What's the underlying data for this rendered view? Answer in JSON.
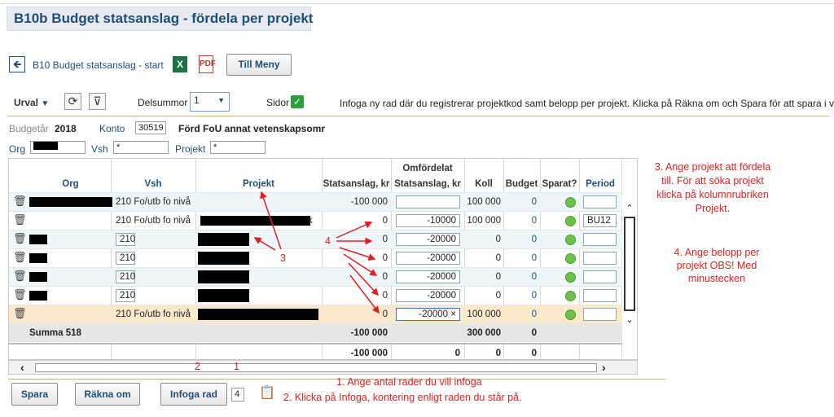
{
  "title": "B10b Budget statsanslag - fördela per projekt",
  "toolbar": {
    "back_link": "B10 Budget statsanslag - start",
    "menu_button": "Till Meny",
    "excel_icon": "excel-icon",
    "pdf_icon": "pdf-icon"
  },
  "filterbar": {
    "urval": "Urval",
    "delsummor_label": "Delsummor",
    "delsummor_value": "1",
    "sidor_label": "Sidor",
    "info": "Infoga ny rad där du registrerar projektkod samt belopp per projekt. Klicka på Räkna om och Spara för att spara i verif."
  },
  "params": {
    "budgetar_label": "Budgetår",
    "budgetar_value": "2018",
    "konto_label": "Konto",
    "konto_value": "30519",
    "konto_desc": "Förd FoU annat vetenskapsomr",
    "org_label": "Org",
    "vsh_label": "Vsh",
    "vsh_value": "*",
    "projekt_label": "Projekt",
    "projekt_value": "*"
  },
  "table": {
    "headers": {
      "org": "Org",
      "vsh": "Vsh",
      "projekt": "Projekt",
      "stat": "Statsanslag, kr",
      "omf_top": "Omfördelat",
      "omf": "Statsanslag, kr",
      "koll": "Koll",
      "budget": "Budget",
      "sparat": "Sparat?",
      "period": "Period"
    },
    "rows": [
      {
        "vsh": "210 Fo/utb fo nivå",
        "stat": "-100 000",
        "omf": "",
        "koll": "100 000",
        "budget": "0",
        "period": ""
      },
      {
        "vsh": "210 Fo/utb fo nivå",
        "proj_tail": "k",
        "stat": "0",
        "omf": "-10000",
        "koll": "100 000",
        "budget": "0",
        "period": "BU12"
      },
      {
        "vsh": "210",
        "stat": "0",
        "omf": "-20000",
        "koll": "0",
        "budget": "0",
        "period": ""
      },
      {
        "vsh": "210",
        "stat": "0",
        "omf": "-20000",
        "koll": "0",
        "budget": "0",
        "period": ""
      },
      {
        "vsh": "210",
        "stat": "0",
        "omf": "-20000",
        "koll": "0",
        "budget": "0",
        "period": ""
      },
      {
        "vsh": "210",
        "stat": "0",
        "omf": "-20000",
        "koll": "0",
        "budget": "0",
        "period": ""
      },
      {
        "vsh": "210 Fo/utb fo nivå",
        "stat": "0",
        "omf": "-20000 ×",
        "koll": "100 000",
        "budget": "0",
        "period": ""
      }
    ],
    "summa": {
      "label": "Summa 518",
      "stat": "-100 000",
      "koll": "300 000",
      "budget": "0"
    },
    "total": {
      "stat": "-100 000",
      "omf": "0",
      "koll": "0",
      "budget": "0"
    }
  },
  "bottom": {
    "spara": "Spara",
    "rakna": "Räkna om",
    "infoga": "Infoga rad",
    "antal": "4",
    "note1": "1. Ange antal rader du vill infoga",
    "note2": "2. Klicka på Infoga, kontering enligt raden du står på."
  },
  "annotations": {
    "a3": "3. Ange projekt att fördela till. För att söka projekt klicka på kolumnrubriken Projekt.",
    "a4": "4. Ange belopp per projekt OBS! Med minustecken",
    "n3": "3",
    "n4": "4",
    "n2": "2",
    "n1": "1"
  },
  "colors": {
    "accent": "#1f4e79",
    "annotation": "#e02020",
    "highlight_row": "#fbe9cc",
    "sparat_ok": "#6cc24a"
  }
}
